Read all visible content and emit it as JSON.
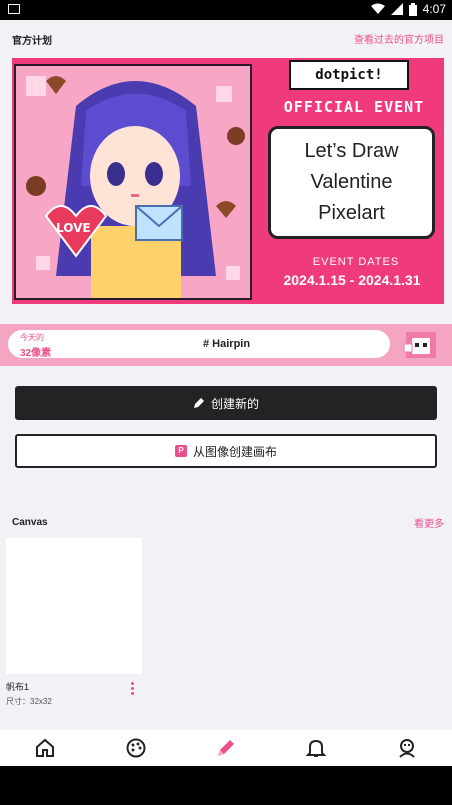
{
  "status_bar": {
    "time": "4:07"
  },
  "header": {
    "title": "官方计划",
    "past_link": "查看过去的官方项目"
  },
  "banner": {
    "logo": "dotpict!",
    "official": "OFFICIAL EVENT",
    "title_lines": [
      "Let’s Draw",
      "Valentine",
      "Pixelart"
    ],
    "art_text": "LOVE",
    "dates_label": "EVENT DATES",
    "dates": "2024.1.15 - 2024.1.31"
  },
  "tag_bar": {
    "today": "今天的",
    "pixels": "32像素",
    "tag": "# Hairpin"
  },
  "buttons": {
    "new": "创建新的",
    "from_image": "从图像创建画布",
    "badge": "P"
  },
  "canvas_section": {
    "title": "Canvas",
    "see_more": "看更多",
    "items": [
      {
        "name": "帆布1",
        "size": "尺寸：32x32"
      }
    ]
  },
  "colors": {
    "accent": "#ee4f8a",
    "dark": "#232325",
    "banner": "#ef3a7b"
  },
  "tabs": [
    {
      "icon": "home-icon",
      "active": false
    },
    {
      "icon": "palette-icon",
      "active": false
    },
    {
      "icon": "brush-icon",
      "active": true
    },
    {
      "icon": "bell-icon",
      "active": false
    },
    {
      "icon": "profile-icon",
      "active": false
    }
  ]
}
